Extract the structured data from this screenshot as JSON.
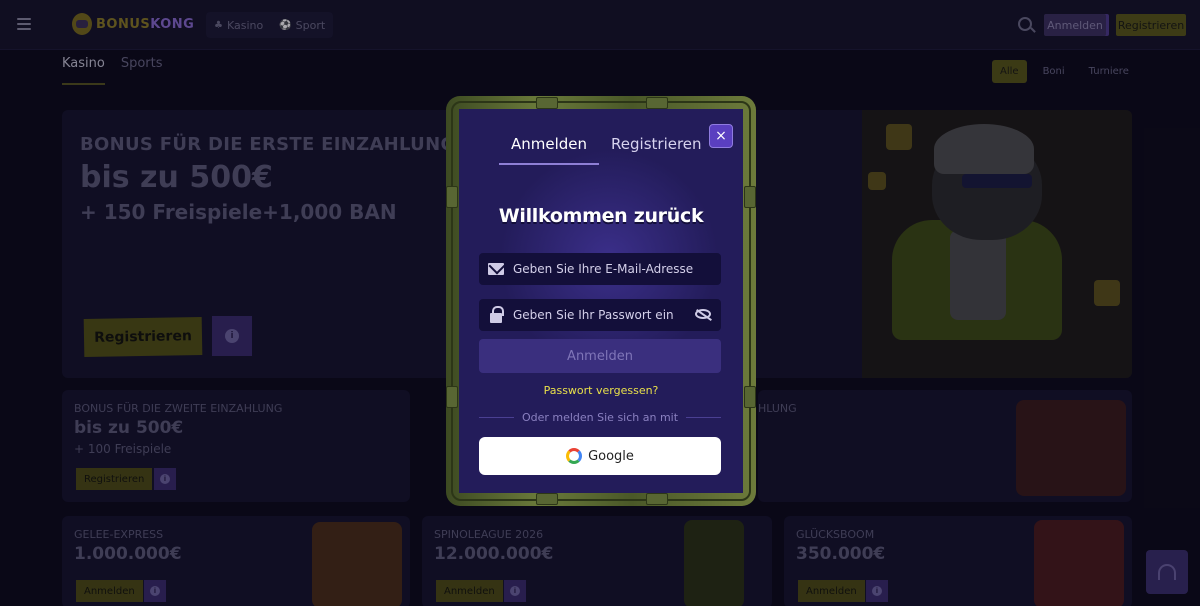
{
  "header": {
    "logo_text_a": "BONUS",
    "logo_text_b": "KONG",
    "nav": [
      {
        "label": "Kasino",
        "icon": "casino-icon"
      },
      {
        "label": "Sport",
        "icon": "sport-icon"
      }
    ],
    "login_label": "Anmelden",
    "register_label": "Registrieren"
  },
  "subnav": {
    "items": [
      "Kasino",
      "Sports"
    ],
    "active": "Kasino"
  },
  "filters": [
    "Alle",
    "Boni",
    "Turniere"
  ],
  "hero": {
    "line1": "BONUS FÜR DIE ERSTE EINZAHLUNG",
    "line2": "bis zu 500€",
    "line3": "+ 150 Freispiele+1,000 BAN",
    "cta": "Registrieren"
  },
  "cards": [
    {
      "title": "BONUS FÜR DIE ZWEITE EINZAHLUNG",
      "value": "bis zu 500€",
      "sub": "+ 100 Freispiele",
      "cta": "Registrieren"
    },
    {
      "title": "HLUNG",
      "value": "",
      "sub": "",
      "cta": ""
    },
    {
      "title": "GELEE-EXPRESS",
      "value": "1.000.000€",
      "cta": "Anmelden"
    },
    {
      "title": "SPINOLEAGUE 2026",
      "value": "12.000.000€",
      "cta": "Anmelden"
    },
    {
      "title": "GLÜCKSBOOM",
      "value": "350.000€",
      "cta": "Anmelden"
    }
  ],
  "modal": {
    "tabs": [
      "Anmelden",
      "Registrieren"
    ],
    "active_tab": "Anmelden",
    "close": "×",
    "welcome": "Willkommen zurück",
    "email_placeholder": "Geben Sie Ihre E-Mail-Adresse...",
    "password_placeholder": "Geben Sie Ihr Passwort ein",
    "submit": "Anmelden",
    "forgot": "Passwort vergessen?",
    "divider": "Oder melden Sie sich an mit",
    "google": "Google"
  },
  "colors": {
    "accent_yellow": "#e9e04a",
    "modal_bg": "#231c5a",
    "accent_purple": "#5a3fc0"
  }
}
